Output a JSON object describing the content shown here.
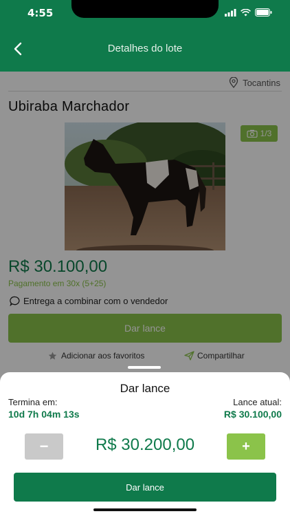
{
  "status_bar": {
    "time": "4:55"
  },
  "header": {
    "title": "Detalhes do lote"
  },
  "lot": {
    "location": "Tocantins",
    "title": "Ubiraba Marchador",
    "photo_counter": "1/3",
    "price": "R$ 30.100,00",
    "installments": "Pagamento em 30x (5+25)",
    "delivery": "Entrega a combinar com o vendedor",
    "bid_button": "Dar lance",
    "favorite_label": "Adicionar aos favoritos",
    "share_label": "Compartilhar"
  },
  "bid_sheet": {
    "title": "Dar lance",
    "ends_label": "Termina em:",
    "ends_value": "10d 7h 04m 13s",
    "current_label": "Lance atual:",
    "current_value": "R$ 30.100,00",
    "minus_label": "−",
    "plus_label": "+",
    "bid_amount": "R$ 30.200,00",
    "submit_label": "Dar lance"
  },
  "icons": [
    "back-icon",
    "location-pin-icon",
    "camera-icon",
    "chat-bubble-icon",
    "star-icon",
    "send-icon",
    "signal-icon",
    "wifi-icon",
    "battery-icon"
  ],
  "colors": {
    "primary": "#0f7a4b",
    "accent": "#8bc34a",
    "disabled": "#c9c9c9"
  }
}
